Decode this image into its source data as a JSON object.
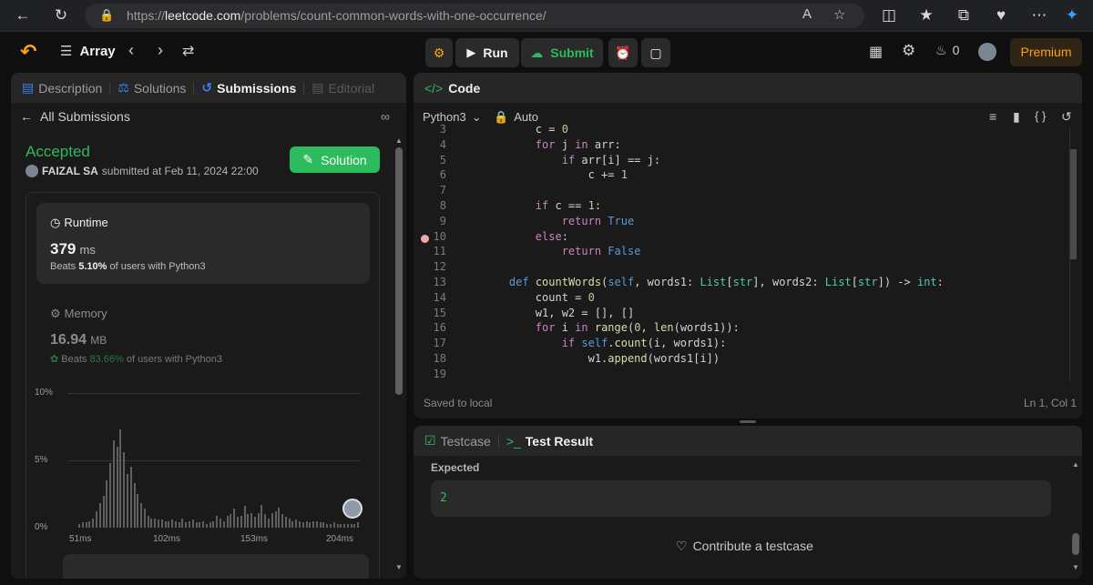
{
  "browser": {
    "url_prefix": "https://",
    "url_domain": "leetcode.com",
    "url_path": "/problems/count-common-words-with-one-occurrence/"
  },
  "topbar": {
    "problem_list": "Array",
    "run": "Run",
    "submit": "Submit",
    "streak_count": "0",
    "premium": "Premium"
  },
  "left": {
    "tabs": [
      "Description",
      "Solutions",
      "Submissions",
      "Editorial"
    ],
    "back": "All Submissions",
    "status": "Accepted",
    "user": "FAIZAL SA",
    "submitted": "submitted at Feb 11, 2024 22:00",
    "solution_btn": "Solution",
    "runtime": {
      "label": "Runtime",
      "value": "379",
      "unit": "ms",
      "beats_pre": "Beats",
      "beats": "5.10%",
      "beats_post": "of users with Python3"
    },
    "memory": {
      "label": "Memory",
      "value": "16.94",
      "unit": "MB",
      "beats_pre": "Beats",
      "beats": "83.66%",
      "beats_post": "of users with Python3"
    },
    "chart_data": {
      "type": "bar",
      "y_ticks": [
        "10%",
        "5%",
        "0%"
      ],
      "x_ticks": [
        "51ms",
        "102ms",
        "153ms",
        "204ms"
      ],
      "ylim": [
        0,
        10
      ],
      "values": [
        0.3,
        0.4,
        0.4,
        0.5,
        0.7,
        1.2,
        1.8,
        2.4,
        3.5,
        4.8,
        6.5,
        6.0,
        7.3,
        5.6,
        4.0,
        4.5,
        3.3,
        2.5,
        1.8,
        1.4,
        0.9,
        0.7,
        0.7,
        0.6,
        0.6,
        0.5,
        0.5,
        0.6,
        0.5,
        0.4,
        0.7,
        0.4,
        0.5,
        0.6,
        0.4,
        0.4,
        0.5,
        0.3,
        0.4,
        0.5,
        0.9,
        0.7,
        0.5,
        0.9,
        1.0,
        1.4,
        0.8,
        0.9,
        1.6,
        1.0,
        1.1,
        0.8,
        1.1,
        1.7,
        1.0,
        0.7,
        1.1,
        1.2,
        1.5,
        1.0,
        0.8,
        0.7,
        0.5,
        0.6,
        0.5,
        0.4,
        0.5,
        0.4,
        0.5,
        0.5,
        0.4,
        0.4,
        0.3,
        0.3,
        0.4,
        0.3,
        0.3,
        0.3,
        0.3,
        0.3,
        0.3,
        0.4
      ]
    }
  },
  "code": {
    "title": "Code",
    "language": "Python3",
    "mode": "Auto",
    "saved": "Saved to local",
    "cursor": "Ln 1, Col 1",
    "lines": [
      {
        "n": "3",
        "text": "        c = 0"
      },
      {
        "n": "4",
        "text": "        for j in arr:"
      },
      {
        "n": "5",
        "text": "            if arr[i] == j:"
      },
      {
        "n": "6",
        "text": "                c += 1"
      },
      {
        "n": "7",
        "text": ""
      },
      {
        "n": "8",
        "text": "        if c == 1:"
      },
      {
        "n": "9",
        "text": "            return True"
      },
      {
        "n": "10",
        "text": "        else:"
      },
      {
        "n": "11",
        "text": "            return False"
      },
      {
        "n": "12",
        "text": ""
      },
      {
        "n": "13",
        "text": "    def countWords(self, words1: List[str], words2: List[str]) -> int:"
      },
      {
        "n": "14",
        "text": "        count = 0"
      },
      {
        "n": "15",
        "text": "        w1, w2 = [], []"
      },
      {
        "n": "16",
        "text": "        for i in range(0, len(words1)):"
      },
      {
        "n": "17",
        "text": "            if self.count(i, words1):"
      },
      {
        "n": "18",
        "text": "                w1.append(words1[i])"
      },
      {
        "n": "19",
        "text": ""
      }
    ]
  },
  "test": {
    "tabs": [
      "Testcase",
      "Test Result"
    ],
    "expected_label": "Expected",
    "expected_value": "2",
    "contribute": "Contribute a testcase"
  },
  "colors": {
    "accent_green": "#2cbb5d",
    "premium_orange": "#ffa116",
    "bg": "#1a1a1a"
  }
}
